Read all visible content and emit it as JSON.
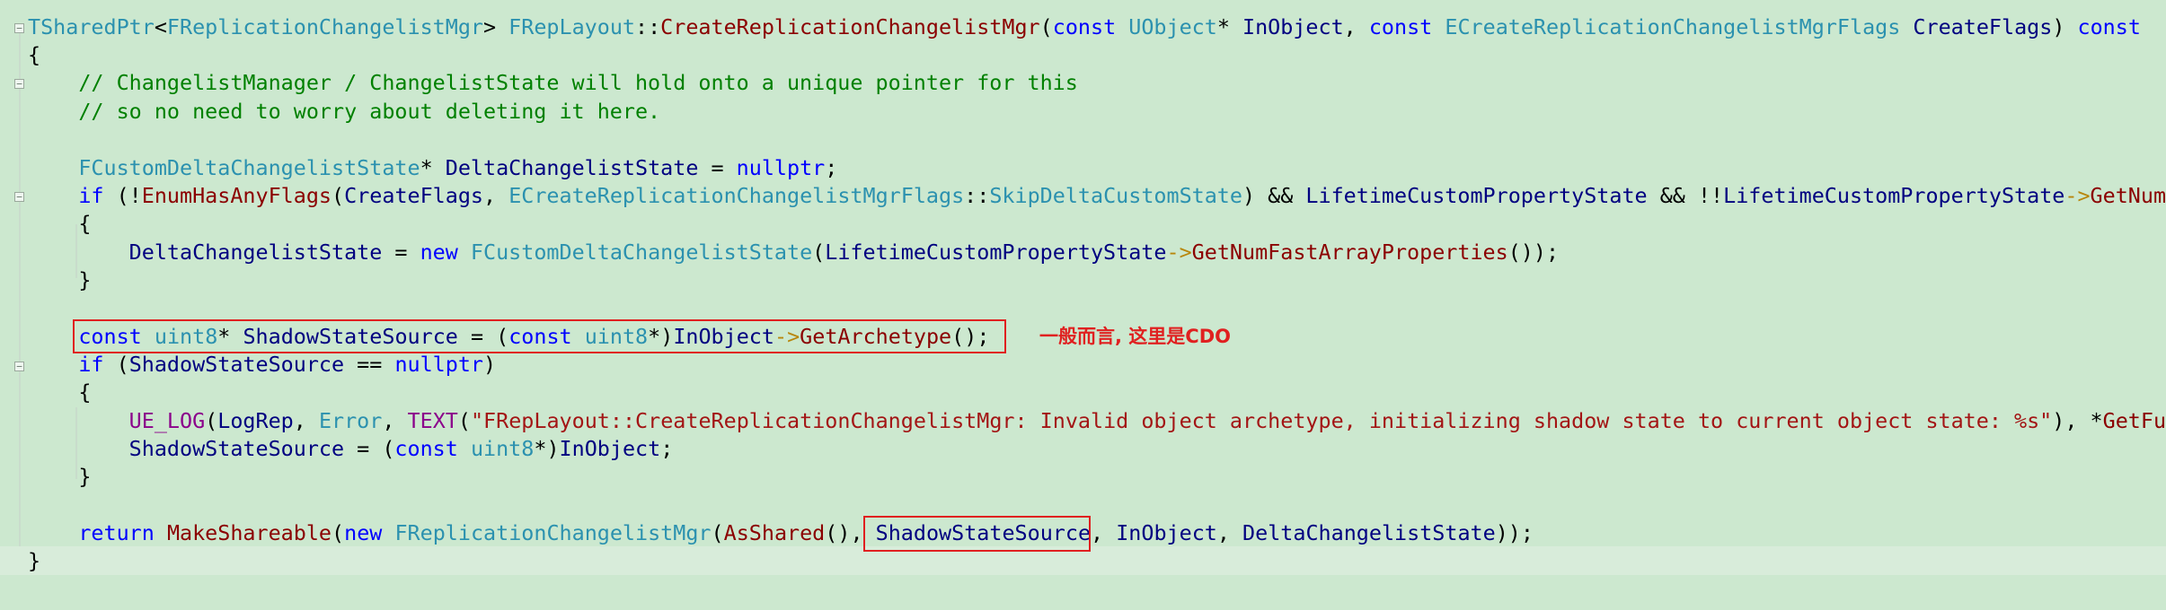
{
  "editor": {
    "lines": [
      [
        [
          "ty",
          "TSharedPtr"
        ],
        [
          "pl",
          "<"
        ],
        [
          "ty",
          "FReplicationChangelistMgr"
        ],
        [
          "pl",
          "> "
        ],
        [
          "ty",
          "FRepLayout"
        ],
        [
          "pl",
          "::"
        ],
        [
          "fn",
          "CreateReplicationChangelistMgr"
        ],
        [
          "pl",
          "("
        ],
        [
          "kw",
          "const"
        ],
        [
          "pl",
          " "
        ],
        [
          "ty",
          "UObject"
        ],
        [
          "pl",
          "* "
        ],
        [
          "id",
          "InObject"
        ],
        [
          "pl",
          ", "
        ],
        [
          "kw",
          "const"
        ],
        [
          "pl",
          " "
        ],
        [
          "ty",
          "ECreateReplicationChangelistMgrFlags"
        ],
        [
          "pl",
          " "
        ],
        [
          "id",
          "CreateFlags"
        ],
        [
          "pl",
          ") "
        ],
        [
          "kw",
          "const"
        ]
      ],
      [
        [
          "pl",
          "{"
        ]
      ],
      [
        [
          "pl",
          "    "
        ],
        [
          "cm",
          "// ChangelistManager / ChangelistState will hold onto a unique pointer for this"
        ]
      ],
      [
        [
          "pl",
          "    "
        ],
        [
          "cm",
          "// so no need to worry about deleting it here."
        ]
      ],
      [],
      [
        [
          "pl",
          "    "
        ],
        [
          "ty",
          "FCustomDeltaChangelistState"
        ],
        [
          "pl",
          "* "
        ],
        [
          "id",
          "DeltaChangelistState"
        ],
        [
          "pl",
          " = "
        ],
        [
          "kw",
          "nullptr"
        ],
        [
          "pl",
          ";"
        ]
      ],
      [
        [
          "pl",
          "    "
        ],
        [
          "kw",
          "if"
        ],
        [
          "pl",
          " (!"
        ],
        [
          "fn",
          "EnumHasAnyFlags"
        ],
        [
          "pl",
          "("
        ],
        [
          "id",
          "CreateFlags"
        ],
        [
          "pl",
          ", "
        ],
        [
          "ty",
          "ECreateReplicationChangelistMgrFlags"
        ],
        [
          "pl",
          "::"
        ],
        [
          "ty",
          "SkipDeltaCustomState"
        ],
        [
          "pl",
          ") && "
        ],
        [
          "id",
          "LifetimeCustomPropertyState"
        ],
        [
          "pl",
          " && !!"
        ],
        [
          "id",
          "LifetimeCustomPropertyState"
        ],
        [
          "op",
          "->"
        ],
        [
          "fn",
          "GetNumF"
        ]
      ],
      [
        [
          "pl",
          "    {"
        ]
      ],
      [
        [
          "pl",
          "        "
        ],
        [
          "id",
          "DeltaChangelistState"
        ],
        [
          "pl",
          " = "
        ],
        [
          "kw",
          "new"
        ],
        [
          "pl",
          " "
        ],
        [
          "ty",
          "FCustomDeltaChangelistState"
        ],
        [
          "pl",
          "("
        ],
        [
          "id",
          "LifetimeCustomPropertyState"
        ],
        [
          "op",
          "->"
        ],
        [
          "fn",
          "GetNumFastArrayProperties"
        ],
        [
          "pl",
          "());"
        ]
      ],
      [
        [
          "pl",
          "    }"
        ]
      ],
      [],
      [
        [
          "pl",
          "    "
        ],
        [
          "kw",
          "const"
        ],
        [
          "pl",
          " "
        ],
        [
          "ty",
          "uint8"
        ],
        [
          "pl",
          "* "
        ],
        [
          "id",
          "ShadowStateSource"
        ],
        [
          "pl",
          " = ("
        ],
        [
          "kw",
          "const"
        ],
        [
          "pl",
          " "
        ],
        [
          "ty",
          "uint8"
        ],
        [
          "pl",
          "*)"
        ],
        [
          "id",
          "InObject"
        ],
        [
          "op",
          "->"
        ],
        [
          "fn",
          "GetArchetype"
        ],
        [
          "pl",
          "();"
        ]
      ],
      [
        [
          "pl",
          "    "
        ],
        [
          "kw",
          "if"
        ],
        [
          "pl",
          " ("
        ],
        [
          "id",
          "ShadowStateSource"
        ],
        [
          "pl",
          " == "
        ],
        [
          "kw",
          "nullptr"
        ],
        [
          "pl",
          ")"
        ]
      ],
      [
        [
          "pl",
          "    {"
        ]
      ],
      [
        [
          "pl",
          "        "
        ],
        [
          "mac",
          "UE_LOG"
        ],
        [
          "pl",
          "("
        ],
        [
          "id",
          "LogRep"
        ],
        [
          "pl",
          ", "
        ],
        [
          "ty",
          "Error"
        ],
        [
          "pl",
          ", "
        ],
        [
          "mac",
          "TEXT"
        ],
        [
          "pl",
          "("
        ],
        [
          "str",
          "\"FRepLayout::CreateReplicationChangelistMgr: Invalid object archetype, initializing shadow state to current object state: %s\""
        ],
        [
          "pl",
          "), *"
        ],
        [
          "fn",
          "GetFul"
        ]
      ],
      [
        [
          "pl",
          "        "
        ],
        [
          "id",
          "ShadowStateSource"
        ],
        [
          "pl",
          " = ("
        ],
        [
          "kw",
          "const"
        ],
        [
          "pl",
          " "
        ],
        [
          "ty",
          "uint8"
        ],
        [
          "pl",
          "*)"
        ],
        [
          "id",
          "InObject"
        ],
        [
          "pl",
          ";"
        ]
      ],
      [
        [
          "pl",
          "    }"
        ]
      ],
      [],
      [
        [
          "pl",
          "    "
        ],
        [
          "kw",
          "return"
        ],
        [
          "pl",
          " "
        ],
        [
          "fn",
          "MakeShareable"
        ],
        [
          "pl",
          "("
        ],
        [
          "kw",
          "new"
        ],
        [
          "pl",
          " "
        ],
        [
          "ty",
          "FReplicationChangelistMgr"
        ],
        [
          "pl",
          "("
        ],
        [
          "fn",
          "AsShared"
        ],
        [
          "pl",
          "(), "
        ],
        [
          "id",
          "ShadowStateSource"
        ],
        [
          "pl",
          ", "
        ],
        [
          "id",
          "InObject"
        ],
        [
          "pl",
          ", "
        ],
        [
          "id",
          "DeltaChangelistState"
        ],
        [
          "pl",
          "));"
        ]
      ],
      [
        [
          "pl",
          "}"
        ]
      ]
    ],
    "fold_glyph": "−",
    "annotation_text": "一般而言, 这里是CDO"
  },
  "colors": {
    "background": "#cce8cf",
    "keyword": "#0000ff",
    "type": "#2b91af",
    "function": "#8b0000",
    "identifier": "#000080",
    "comment": "#008000",
    "string": "#a31515",
    "highlight_box": "#e02020"
  }
}
